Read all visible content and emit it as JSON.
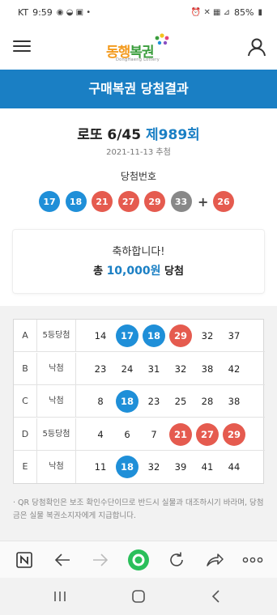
{
  "status_bar": {
    "carrier": "KT",
    "time": "9:59",
    "battery": "85%"
  },
  "app": {
    "logo_text_1": "동행",
    "logo_text_2": "복권",
    "logo_sub": "DongHaeng Lottery"
  },
  "page_title": "구매복권 당첨결과",
  "game": {
    "name": "로또 6/45",
    "round": "제989회",
    "date": "2021-11-13 추첨",
    "winning_label": "당첨번호",
    "winning_numbers": [
      "17",
      "18",
      "21",
      "27",
      "29",
      "33"
    ],
    "plus_sign": "+",
    "bonus_number": "26"
  },
  "result": {
    "message": "축하합니다!",
    "prize_prefix": "총",
    "prize_amount": "10,000원",
    "prize_suffix": "당첨"
  },
  "tickets": [
    {
      "letter": "A",
      "status": "5등당첨",
      "numbers": [
        "14",
        "17",
        "18",
        "29",
        "32",
        "37"
      ]
    },
    {
      "letter": "B",
      "status": "낙첨",
      "numbers": [
        "23",
        "24",
        "31",
        "32",
        "38",
        "42"
      ]
    },
    {
      "letter": "C",
      "status": "낙첨",
      "numbers": [
        "8",
        "18",
        "23",
        "25",
        "28",
        "38"
      ]
    },
    {
      "letter": "D",
      "status": "5등당첨",
      "numbers": [
        "4",
        "6",
        "7",
        "21",
        "27",
        "29"
      ]
    },
    {
      "letter": "E",
      "status": "낙첨",
      "numbers": [
        "11",
        "18",
        "32",
        "39",
        "41",
        "44"
      ]
    }
  ],
  "notice": "· QR 당첨확인은 보조 확인수단이므로 반드시 실물과 대조하시기 바라며, 당첨금은 실물 복권소지자에게 지급합니다.",
  "colors": {
    "primary_blue": "#1a7fc4",
    "ball_blue": "#1f8fd8",
    "ball_red": "#e55b4f",
    "ball_gray": "#888888",
    "browser_green": "#2bbf5b"
  },
  "icons": {
    "menu": "hamburger-icon",
    "user": "user-icon",
    "browser_n": "naver-n-icon",
    "back": "arrow-left-icon",
    "forward": "arrow-right-icon",
    "home": "green-circle-icon",
    "refresh": "refresh-icon",
    "share": "share-icon",
    "more": "more-dots-icon"
  }
}
